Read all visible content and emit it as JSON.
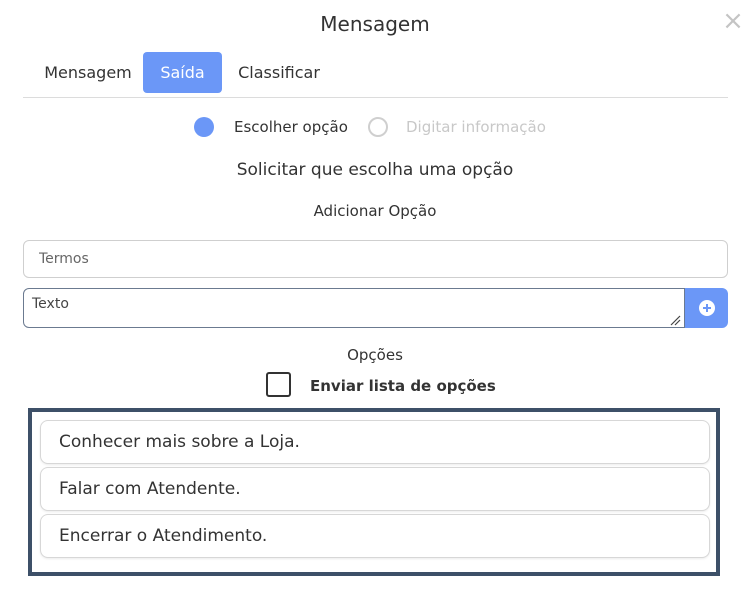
{
  "modal": {
    "title": "Mensagem",
    "close_icon": "×"
  },
  "tabs": [
    {
      "label": "Mensagem",
      "active": false
    },
    {
      "label": "Saída",
      "active": true
    },
    {
      "label": "Classificar",
      "active": false
    }
  ],
  "output_mode": {
    "options": [
      {
        "label": "Escolher opção",
        "selected": true
      },
      {
        "label": "Digitar informação",
        "selected": false
      }
    ]
  },
  "section": {
    "title": "Solicitar que escolha uma opção",
    "add_option_label": "Adicionar Opção"
  },
  "form": {
    "terms_placeholder": "Termos",
    "text_placeholder": "Texto",
    "add_button_icon": "plus-circle-icon"
  },
  "options_section": {
    "label": "Opções",
    "send_list_label": "Enviar lista de opções",
    "send_list_checked": false,
    "items": [
      "Conhecer mais sobre a Loja.",
      "Falar com Atendente.",
      "Encerrar o Atendimento."
    ]
  },
  "colors": {
    "accent": "#6b97f7",
    "highlight_border": "#3d5068"
  }
}
